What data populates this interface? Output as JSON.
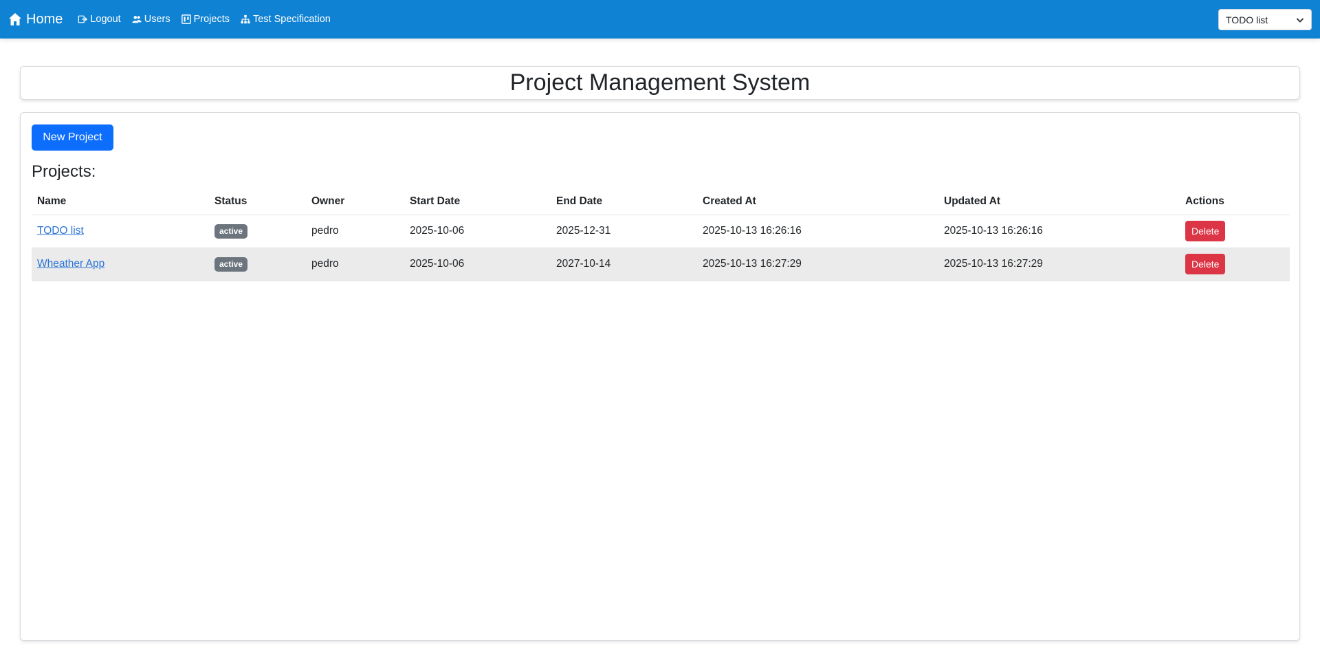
{
  "navbar": {
    "brand_label": "Home",
    "links": [
      {
        "label": "Logout",
        "icon": "logout-icon"
      },
      {
        "label": "Users",
        "icon": "users-icon"
      },
      {
        "label": "Projects",
        "icon": "projects-icon"
      },
      {
        "label": "Test Specification",
        "icon": "sitemap-icon"
      }
    ],
    "project_select": {
      "selected": "TODO list",
      "icon": "chevron-down-icon"
    },
    "bg_color": "#0f82d4"
  },
  "page": {
    "title": "Project Management System",
    "new_project_label": "New Project",
    "section_title": "Projects:"
  },
  "table": {
    "columns": [
      "Name",
      "Status",
      "Owner",
      "Start Date",
      "End Date",
      "Created At",
      "Updated At",
      "Actions"
    ],
    "rows": [
      {
        "name": "TODO list",
        "status": "active",
        "owner": "pedro",
        "start_date": "2025-10-06",
        "end_date": "2025-12-31",
        "created_at": "2025-10-13 16:26:16",
        "updated_at": "2025-10-13 16:26:16",
        "action_label": "Delete"
      },
      {
        "name": "Wheather App",
        "status": "active",
        "owner": "pedro",
        "start_date": "2025-10-06",
        "end_date": "2027-10-14",
        "created_at": "2025-10-13 16:27:29",
        "updated_at": "2025-10-13 16:27:29",
        "action_label": "Delete"
      }
    ]
  },
  "colors": {
    "primary": "#0d6efd",
    "danger": "#dc3545",
    "badge_secondary": "#6c757d"
  }
}
